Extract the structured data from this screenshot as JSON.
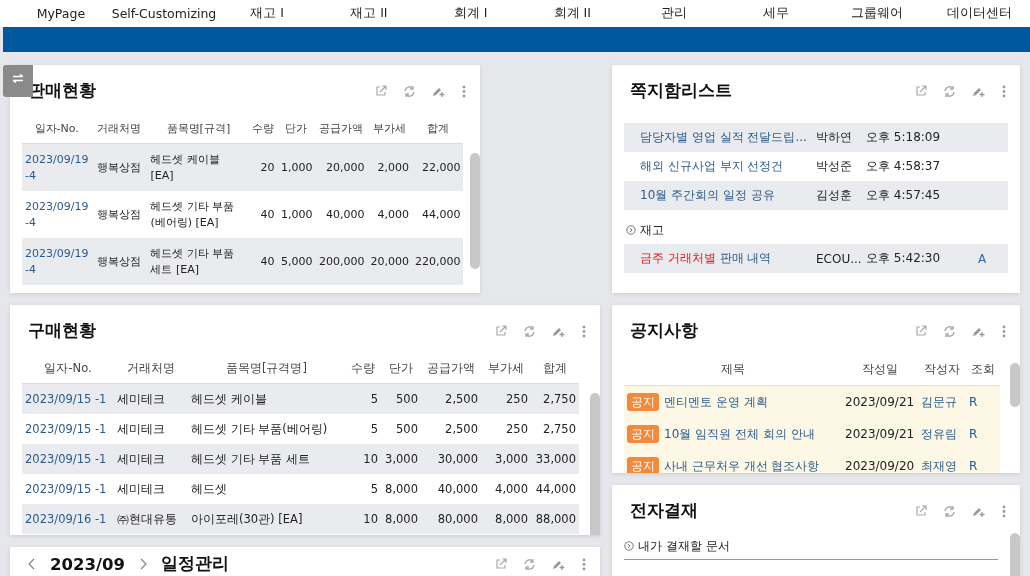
{
  "nav": [
    "MyPage",
    "Self-Customizing",
    "재고 I",
    "재고 II",
    "회계 I",
    "회계 II",
    "관리",
    "세무",
    "그룹웨어",
    "데이터센터"
  ],
  "sales": {
    "title": "판매현황",
    "columns": [
      "일자-No.",
      "거래처명",
      "품목명[규격]",
      "수량",
      "단가",
      "공급가액",
      "부가세",
      "합계"
    ],
    "rows": [
      [
        "2023/09/19 -4",
        "행복상점",
        "헤드셋 케이블 [EA]",
        "20",
        "1,000",
        "20,000",
        "2,000",
        "22,000"
      ],
      [
        "2023/09/19 -4",
        "행복상점",
        "헤드셋 기타 부품(베어링) [EA]",
        "40",
        "1,000",
        "40,000",
        "4,000",
        "44,000"
      ],
      [
        "2023/09/19 -4",
        "행복상점",
        "헤드셋 기타 부품 세트 [EA]",
        "40",
        "5,000",
        "200,000",
        "20,000",
        "220,000"
      ]
    ]
  },
  "purchase": {
    "title": "구매현황",
    "columns": [
      "일자-No.",
      "거래처명",
      "품목명[규격명]",
      "수량",
      "단가",
      "공급가액",
      "부가세",
      "합계"
    ],
    "rows": [
      [
        "2023/09/15 -1",
        "세미테크",
        "헤드셋 케이블",
        "5",
        "500",
        "2,500",
        "250",
        "2,750"
      ],
      [
        "2023/09/15 -1",
        "세미테크",
        "헤드셋 기타 부품(베어링)",
        "5",
        "500",
        "2,500",
        "250",
        "2,750"
      ],
      [
        "2023/09/15 -1",
        "세미테크",
        "헤드셋 기타 부품 세트",
        "10",
        "3,000",
        "30,000",
        "3,000",
        "33,000"
      ],
      [
        "2023/09/15 -1",
        "세미테크",
        "헤드셋",
        "5",
        "8,000",
        "40,000",
        "4,000",
        "44,000"
      ],
      [
        "2023/09/16 -1",
        "㈜현대유통",
        "아이포레(30관) [EA]",
        "10",
        "8,000",
        "80,000",
        "8,000",
        "88,000"
      ]
    ]
  },
  "calendar": {
    "month": "2023/09",
    "title": "일정관리"
  },
  "notes": {
    "title": "쪽지함리스트",
    "items": [
      {
        "subject": "담당자별 영업 실적 전달드립...",
        "sender": "박하연",
        "time": "오후 5:18:09"
      },
      {
        "subject": "해외 신규사업 부지 선정건",
        "sender": "박성준",
        "time": "오후 4:58:37"
      },
      {
        "subject": "10월 주간회의 일정 공유",
        "sender": "김성훈",
        "time": "오후 4:57:45"
      }
    ],
    "section": "재고",
    "section_items": [
      {
        "highlight": "금주 거래처별",
        "subject": "판매 내역",
        "sender": "ECOU...",
        "time": "오후 5:42:30",
        "flag": "A"
      }
    ]
  },
  "notices": {
    "title": "공지사항",
    "columns": [
      "제목",
      "작성일",
      "작성자",
      "조회"
    ],
    "rows": [
      {
        "tag": "공지",
        "subject": "멘티멘토 운영 계획",
        "date": "2023/09/21",
        "author": "김문규",
        "views": "R"
      },
      {
        "tag": "공지",
        "subject": "10월 임직원 전체 회의 안내",
        "date": "2023/09/21",
        "author": "정유림",
        "views": "R"
      },
      {
        "tag": "공지",
        "subject": "사내 근무처우 개선 협조사항",
        "date": "2023/09/20",
        "author": "최재영",
        "views": "R"
      }
    ]
  },
  "approval": {
    "title": "전자결재",
    "section": "내가 결재할 문서"
  }
}
